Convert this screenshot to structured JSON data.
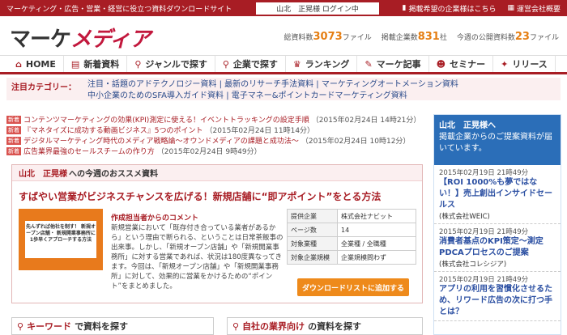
{
  "topbar": {
    "tagline": "マーケティング・広告・営業・経営に役立つ資料ダウンロードサイト",
    "login": "山北　正晃様 ログイン中",
    "links": [
      "掲載希望の企業様はこちら",
      "運営会社概要"
    ]
  },
  "header": {
    "logo_main": "マーケ",
    "logo_accent": "メディア",
    "stats": [
      {
        "label": "総資料数",
        "num": "3073",
        "unit": "ファイル"
      },
      {
        "label": "掲載企業数",
        "num": "831",
        "unit": "社"
      },
      {
        "label": "今週の公開資料数",
        "num": "23",
        "unit": "ファイル"
      }
    ]
  },
  "nav": [
    {
      "label": "HOME",
      "icon": "home-icon"
    },
    {
      "label": "新着資料",
      "icon": "new-icon"
    },
    {
      "label": "ジャンルで探す",
      "icon": "search-icon"
    },
    {
      "label": "企業で探す",
      "icon": "company-icon"
    },
    {
      "label": "ランキング",
      "icon": "crown-icon"
    },
    {
      "label": "マーケ記事",
      "icon": "pen-icon"
    },
    {
      "label": "セミナー",
      "icon": "people-icon"
    },
    {
      "label": "リリース",
      "icon": "megaphone-icon"
    }
  ],
  "categories": {
    "label": "注目カテゴリー：",
    "line1": "注目・話題のアドテクノロジー資料 | 最新のリサーチ手法資料 | マーケティングオートメーション資料",
    "line2": "中小企業のためのSFA導入ガイド資料 | 電子マネー&ポイントカードマーケティング資料"
  },
  "news": [
    {
      "badge": "新着",
      "title": "コンテンツマーケティングの効果(KPI)測定に使える！イベントトラッキングの設定手順",
      "date": "（2015年02月24日 14時21分）"
    },
    {
      "badge": "新着",
      "title": "『マネタイズに成功する動画ビジネス』5つのポイント",
      "date": "（2015年02月24日 11時14分）"
    },
    {
      "badge": "新着",
      "title": "デジタルマーケティング時代のメディア戦略論～オウンドメディアの課題と成功法～",
      "date": "（2015年02月24日 10時12分）"
    },
    {
      "badge": "新着",
      "title": "広告業界最強のセールスチームの作り方",
      "date": "（2015年02月24日 9時49分）"
    }
  ],
  "recommend": {
    "user": "山北　正晃様",
    "heading": "への今週のおススメ資料",
    "title": "すばやい営業がビジネスチャンスを広げる！新規店舗に“即アポイント”をとる方法",
    "thumb_text": "先んずれば他社を制す！ 新規オープン店舗・ 新規開業事務所に 1歩早くアプローチする方法",
    "comment_heading": "作成担当者からのコメント",
    "comment": "新規営業において「既存付き合っている業者があるから」という理由で断られる、ということは日常茶飯事の出来事。しかし、「新規オープン店舗」や「新規開業事務所」に対する営業であれば、状況は180度異なってきます。今回は、「新規オープン店舗」や「新規開業事務所」に対して、効果的に営業をかけるための“ポイント”をまとめました。",
    "info": [
      {
        "k": "提供企業",
        "v": "株式会社ナビット"
      },
      {
        "k": "ページ数",
        "v": "14"
      },
      {
        "k": "対象業種",
        "v": "全業種 / 全職種"
      },
      {
        "k": "対象企業規模",
        "v": "企業規模問わず"
      }
    ],
    "button": "ダウンロードリストに追加する"
  },
  "search": {
    "left_kw": "キーワード",
    "left_rest": "で資料を探す",
    "right_kw": "自社の業界向け",
    "right_rest": "の資料を探す"
  },
  "sidebar": {
    "name": "山北　正晃様へ",
    "msg": "掲載企業からのご提案資料が届いています。",
    "items": [
      {
        "ts": "2015年02月19日 21時49分",
        "title": "【ROI 1000%も夢ではない！】売上創出インサイドセールス",
        "co": "(株式会社WEIC)"
      },
      {
        "ts": "2015年02月19日 21時49分",
        "title": "消費者基点のKPI策定〜測定PDCAプロセスのご提案",
        "co": "(株式会社コレシジア)"
      },
      {
        "ts": "2015年02月19日 21時49分",
        "title": "アプリの利用を習慣化させるため、リワード広告の次に打つ手とは？",
        "co": ""
      }
    ]
  }
}
